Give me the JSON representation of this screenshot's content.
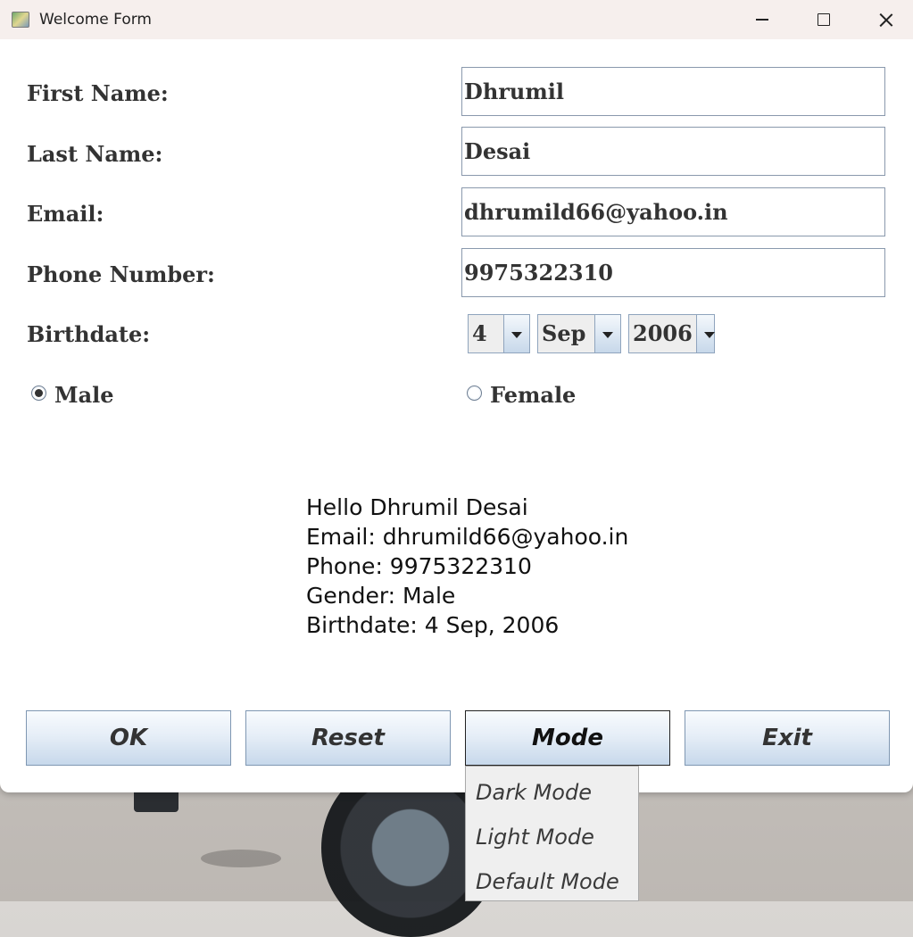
{
  "window": {
    "title": "Welcome Form"
  },
  "form": {
    "first_name_label": "First Name:",
    "first_name_value": "Dhrumil",
    "last_name_label": "Last Name:",
    "last_name_value": "Desai",
    "email_label": "Email:",
    "email_value": "dhrumild66@yahoo.in",
    "phone_label": "Phone Number:",
    "phone_value": "9975322310",
    "birthdate_label": "Birthdate:",
    "birth_day": "4",
    "birth_month": "Sep",
    "birth_year": "2006",
    "gender_male_label": "Male",
    "gender_female_label": "Female",
    "gender_selected": "Male"
  },
  "output": {
    "line1": "Hello Dhrumil Desai",
    "line2": "Email: dhrumild66@yahoo.in",
    "line3": "Phone: 9975322310",
    "line4": "Gender: Male",
    "line5": "Birthdate: 4 Sep, 2006"
  },
  "buttons": {
    "ok": "OK",
    "reset": "Reset",
    "mode": "Mode",
    "exit": "Exit"
  },
  "mode_menu": {
    "items": [
      "Dark Mode",
      "Light Mode",
      "Default Mode"
    ]
  }
}
